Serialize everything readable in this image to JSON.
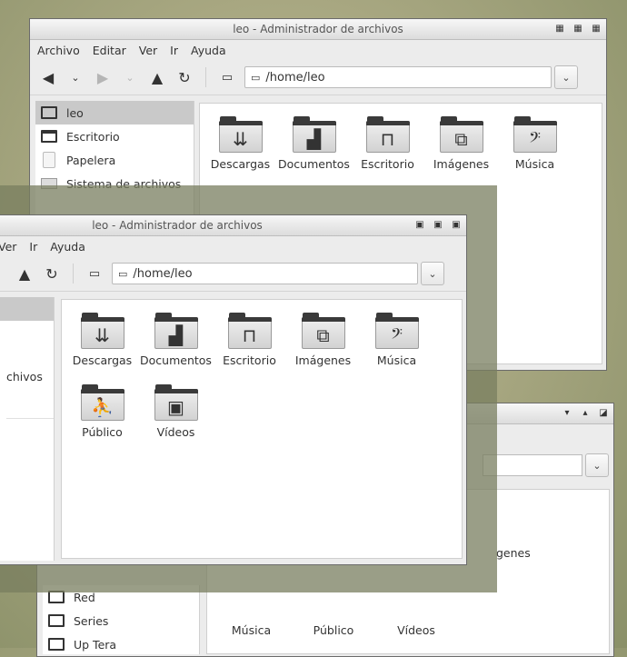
{
  "back_window": {
    "title": "leo - Administrador de archivos",
    "menu": [
      "Archivo",
      "Editar",
      "Ver",
      "Ir",
      "Ayuda"
    ],
    "path": "/home/leo",
    "sidebar": [
      {
        "label": "leo",
        "icon": "computer-icon",
        "selected": true
      },
      {
        "label": "Escritorio",
        "icon": "desktop-folder-icon"
      },
      {
        "label": "Papelera",
        "icon": "trash-icon"
      },
      {
        "label": "Sistema de archivos",
        "icon": "drive-icon"
      }
    ],
    "folders": [
      {
        "label": "Descargas",
        "glyph": "⇊"
      },
      {
        "label": "Documentos",
        "glyph": "▟"
      },
      {
        "label": "Escritorio",
        "glyph": "⊓"
      },
      {
        "label": "Imágenes",
        "glyph": "⧉"
      },
      {
        "label": "Música",
        "glyph": "𝄢"
      }
    ]
  },
  "front_window": {
    "title": "leo - Administrador de archivos",
    "menu": [
      "Ver",
      "Ir",
      "Ayuda"
    ],
    "path": "/home/leo",
    "sidebar_partial": "chivos",
    "folders": [
      {
        "label": "Descargas",
        "glyph": "⇊"
      },
      {
        "label": "Documentos",
        "glyph": "▟"
      },
      {
        "label": "Escritorio",
        "glyph": "⊓"
      },
      {
        "label": "Imágenes",
        "glyph": "⧉"
      },
      {
        "label": "Música",
        "glyph": "𝄢"
      },
      {
        "label": "Público",
        "glyph": "⛹"
      },
      {
        "label": "Vídeos",
        "glyph": "▣"
      }
    ]
  },
  "bottom_window": {
    "sidebar": [
      {
        "label": "Red"
      },
      {
        "label": "Series"
      },
      {
        "label": "Up Tera"
      }
    ],
    "folders": [
      {
        "label": "Música"
      },
      {
        "label": "Público"
      },
      {
        "label": "Vídeos"
      }
    ],
    "partial_label": "genes"
  }
}
